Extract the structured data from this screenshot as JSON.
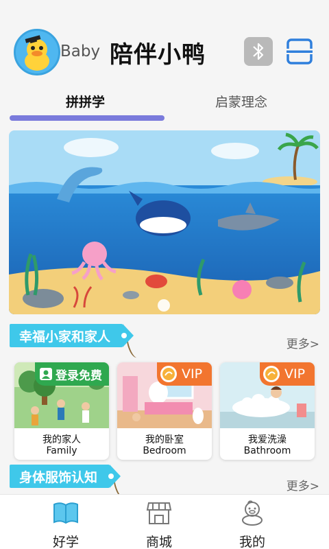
{
  "header": {
    "brand": "Baby",
    "title": "陪伴小鸭",
    "bluetooth_icon": "bluetooth-icon",
    "scan_icon": "scan-icon"
  },
  "tabs": [
    {
      "label": "拼拼学",
      "active": true
    },
    {
      "label": "启蒙理念",
      "active": false
    }
  ],
  "banner": {
    "pager_dots": 1,
    "active_dot": 1
  },
  "sections": [
    {
      "title": "幸福小家和家人",
      "more": "更多>",
      "cards": [
        {
          "title_cn": "我的家人",
          "title_en": "Family",
          "badge": "登录免费"
        },
        {
          "title_cn": "我的卧室",
          "title_en": "Bedroom",
          "badge": "VIP"
        },
        {
          "title_cn": "我爱洗澡",
          "title_en": "Bathroom",
          "badge": "VIP"
        }
      ]
    },
    {
      "title": "身体服饰认知",
      "more": "更多>"
    }
  ],
  "bottom_nav": [
    {
      "label": "好学",
      "icon": "book-icon",
      "active": true
    },
    {
      "label": "商城",
      "icon": "shop-icon",
      "active": false
    },
    {
      "label": "我的",
      "icon": "duck-icon",
      "active": false
    }
  ],
  "colors": {
    "tab_underline": "#7a7bdc",
    "section_tag": "#3fc8ea",
    "free_badge": "#2fa84f",
    "vip_badge": "#f2752f",
    "scan_icon": "#2f7fdc",
    "bluetooth_bg": "#b9b9b9"
  }
}
